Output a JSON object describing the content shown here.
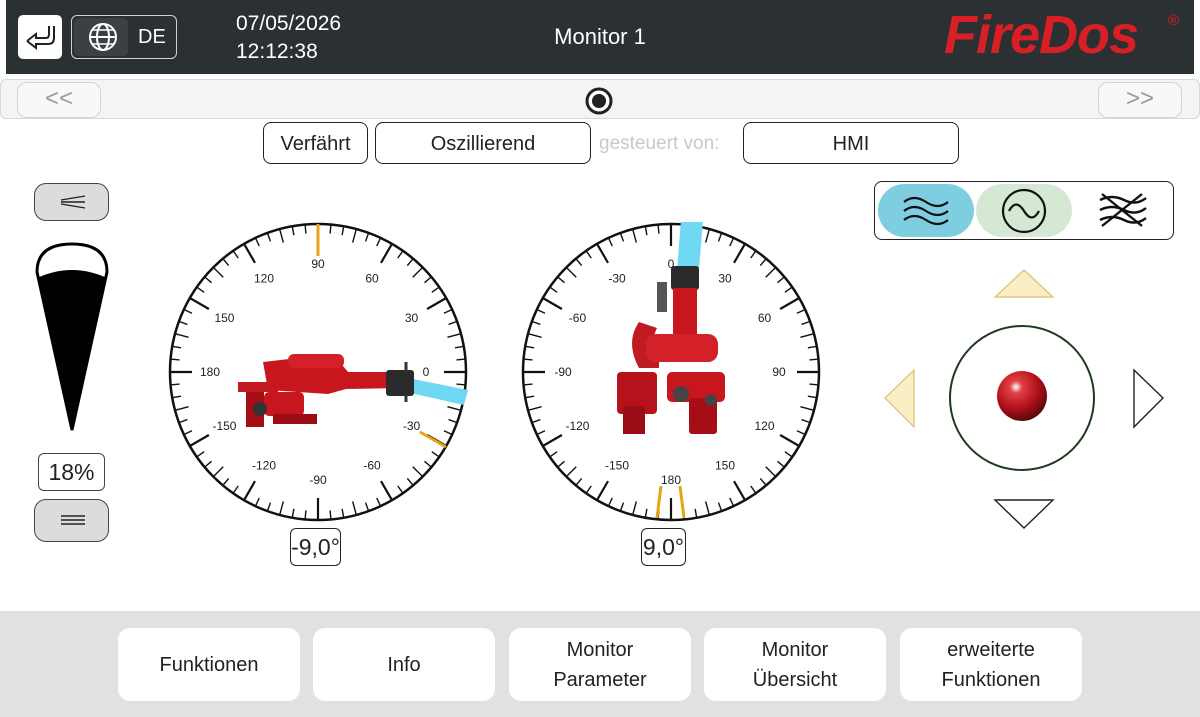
{
  "header": {
    "language": "DE",
    "date": "07/05/2026",
    "time": "12:12:38",
    "title": "Monitor 1",
    "logo": "FireDos",
    "logo_mark": "®"
  },
  "nav": {
    "prev_label": "<<",
    "next_label": ">>"
  },
  "status": {
    "state": "Verfährt",
    "mode": "Oszillierend",
    "controlled_by_label": "gesteuert von:",
    "controller": "HMI"
  },
  "jet": {
    "percent": "18%"
  },
  "gauge_horizontal": {
    "labels": [
      "0",
      "30",
      "60",
      "90",
      "120",
      "150",
      "180",
      "-150",
      "-120",
      "-90",
      "-60",
      "-30"
    ],
    "angle": "-9,0°"
  },
  "gauge_vertical": {
    "labels": [
      "0",
      "30",
      "60",
      "90",
      "120",
      "150",
      "180",
      "-150",
      "-120",
      "-90",
      "-60",
      "-30"
    ],
    "angle": "9,0°"
  },
  "colors": {
    "header_bg": "#2b3033",
    "brand_red": "#d81f26",
    "water_jet": "#6fd8f2",
    "limit_marker": "#e8a317",
    "mode_active": "#7fcde0",
    "mode_oscillate": "#d4e8d4",
    "joystick_ball": "#b5121b"
  },
  "mode_icons": [
    "jet-waves-icon",
    "oscillate-sine-icon",
    "spray-cross-icon"
  ],
  "joystick": {
    "icons": [
      "arrow-up-icon",
      "arrow-left-icon",
      "arrow-right-icon",
      "arrow-down-icon"
    ]
  },
  "footer": {
    "buttons": [
      "Funktionen",
      "Info",
      "Monitor\nParameter",
      "Monitor\nÜbersicht",
      "erweiterte\nFunktionen"
    ]
  }
}
